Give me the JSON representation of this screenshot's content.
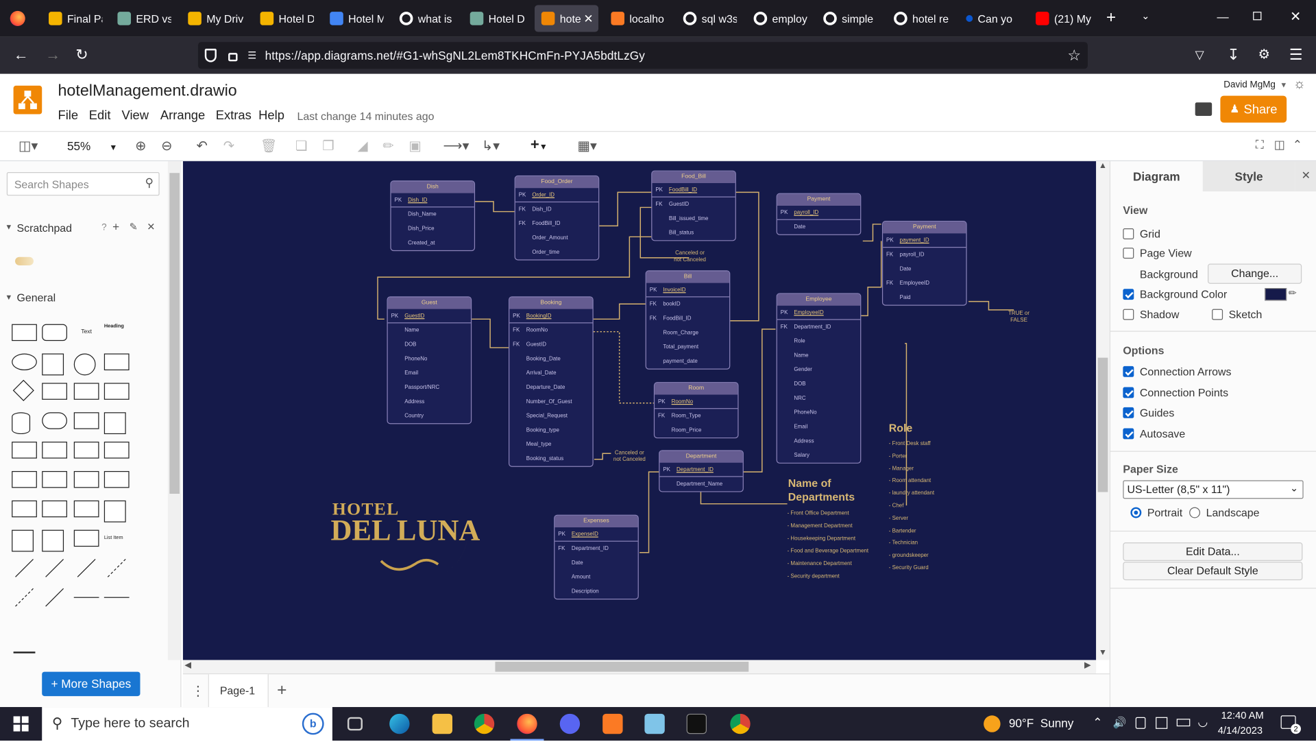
{
  "browser": {
    "tabs": [
      {
        "label": "Final Pa",
        "icon": "google-drive-icon",
        "color": "#f4b400"
      },
      {
        "label": "ERD vs",
        "icon": "chatgpt-icon",
        "color": "#74aa9c"
      },
      {
        "label": "My Driv",
        "icon": "google-drive-icon",
        "color": "#f4b400"
      },
      {
        "label": "Hotel D",
        "icon": "google-drive-icon",
        "color": "#f4b400"
      },
      {
        "label": "Hotel M",
        "icon": "google-docs-icon",
        "color": "#4285f4"
      },
      {
        "label": "what is",
        "icon": "google-icon",
        "color": "#ffffff"
      },
      {
        "label": "Hotel D",
        "icon": "chatgpt-icon",
        "color": "#74aa9c"
      },
      {
        "label": "hote",
        "icon": "drawio-icon",
        "color": "#f08705"
      },
      {
        "label": "localho",
        "icon": "xampp-icon",
        "color": "#fb7a24"
      },
      {
        "label": "sql w3s",
        "icon": "google-icon",
        "color": "#ffffff"
      },
      {
        "label": "employ",
        "icon": "google-icon",
        "color": "#ffffff"
      },
      {
        "label": "simple",
        "icon": "google-icon",
        "color": "#ffffff"
      },
      {
        "label": "hotel re",
        "icon": "google-icon",
        "color": "#ffffff"
      },
      {
        "label": "Can yo",
        "icon": "dot-icon",
        "color": "#0b57d0"
      },
      {
        "label": "(21) My",
        "icon": "youtube-icon",
        "color": "#ff0000"
      }
    ],
    "url": "https://app.diagrams.net/#G1-whSgNL2Lem8TKHCmFn-PYJA5bdtLzGy"
  },
  "app": {
    "title": "hotelManagement.drawio",
    "menu": [
      "File",
      "Edit",
      "View",
      "Arrange",
      "Extras",
      "Help"
    ],
    "last_change": "Last change 14 minutes ago",
    "user": "David MgMg",
    "share_label": "Share",
    "accent": "#f08705"
  },
  "toolbar": {
    "zoom": "55%"
  },
  "left_panel": {
    "search_placeholder": "Search Shapes",
    "scratchpad_label": "Scratchpad",
    "scratchpad_help": "?",
    "general_label": "General",
    "shape_text": "Text",
    "shape_heading": "Heading",
    "shape_list_item": "List Item",
    "more_shapes": "+ More Shapes"
  },
  "diagram": {
    "background": "#151a4a",
    "entities": [
      {
        "title": "Dish",
        "pk": "Dish_ID",
        "fields": [
          [
            "",
            "Dish_Name"
          ],
          [
            "",
            "Dish_Price"
          ],
          [
            "",
            "Created_at"
          ]
        ]
      },
      {
        "title": "Food_Order",
        "pk": "Order_ID",
        "fields": [
          [
            "FK",
            "Dish_ID"
          ],
          [
            "FK",
            "FoodBill_ID"
          ],
          [
            "",
            "Order_Amount"
          ],
          [
            "",
            "Order_time"
          ]
        ]
      },
      {
        "title": "Food_Bill",
        "pk": "FoodBill_ID",
        "fields": [
          [
            "FK",
            "GuestID"
          ],
          [
            "",
            "Bill_issued_time"
          ],
          [
            "",
            "Bill_status"
          ]
        ]
      },
      {
        "title": "Payment",
        "pk": "payroll_ID",
        "fields": [
          [
            "",
            "Date"
          ]
        ]
      },
      {
        "title": "Payment",
        "pk": "payment_ID",
        "fields": [
          [
            "FK",
            "payroll_ID"
          ],
          [
            "",
            "Date"
          ],
          [
            "FK",
            "EmployeeID"
          ],
          [
            "",
            "Paid"
          ]
        ]
      },
      {
        "title": "Guest",
        "pk": "GuestID",
        "fields": [
          [
            "",
            "Name"
          ],
          [
            "",
            "DOB"
          ],
          [
            "",
            "PhoneNo"
          ],
          [
            "",
            "Email"
          ],
          [
            "",
            "Passport/NRC"
          ],
          [
            "",
            "Address"
          ],
          [
            "",
            "Country"
          ]
        ]
      },
      {
        "title": "Booking",
        "pk": "BookingID",
        "fields": [
          [
            "FK",
            "RoomNo"
          ],
          [
            "FK",
            "GuestID"
          ],
          [
            "",
            "Booking_Date"
          ],
          [
            "",
            "Arrival_Date"
          ],
          [
            "",
            "Departure_Date"
          ],
          [
            "",
            "Number_Of_Guest"
          ],
          [
            "",
            "Special_Request"
          ],
          [
            "",
            "Booking_type"
          ],
          [
            "",
            "Meal_type"
          ],
          [
            "",
            "Booking_status"
          ]
        ]
      },
      {
        "title": "Bill",
        "pk": "InvoiceID",
        "fields": [
          [
            "FK",
            "bookID"
          ],
          [
            "FK",
            "FoodBill_ID"
          ],
          [
            "",
            "Room_Charge"
          ],
          [
            "",
            "Total_payment"
          ],
          [
            "",
            "payment_date"
          ]
        ]
      },
      {
        "title": "Room",
        "pk": "RoomNo",
        "fields": [
          [
            "FK",
            "Room_Type"
          ],
          [
            "",
            "Room_Price"
          ]
        ]
      },
      {
        "title": "Employee",
        "pk": "EmployeeID",
        "fields": [
          [
            "FK",
            "Department_ID"
          ],
          [
            "",
            "Role"
          ],
          [
            "",
            "Name"
          ],
          [
            "",
            "Gender"
          ],
          [
            "",
            "DOB"
          ],
          [
            "",
            "NRC"
          ],
          [
            "",
            "PhoneNo"
          ],
          [
            "",
            "Email"
          ],
          [
            "",
            "Address"
          ],
          [
            "",
            "Salary"
          ]
        ]
      },
      {
        "title": "Department",
        "pk": "Department_ID",
        "fields": [
          [
            "",
            "Department_Name"
          ]
        ]
      },
      {
        "title": "Expenses",
        "pk": "ExpenseID",
        "fields": [
          [
            "FK",
            "Department_ID"
          ],
          [
            "",
            "Date"
          ],
          [
            "",
            "Amount"
          ],
          [
            "",
            "Description"
          ]
        ]
      }
    ],
    "captions": {
      "food_bill_status": "Canceled or\nnot Canceled",
      "booking_status": "Canceled or\nnot Canceled",
      "paid": "TRUE or\nFALSE"
    },
    "logo": {
      "line1": "HOTEL",
      "line2": "DEL LUNA"
    },
    "departments_title": "Name of\nDepartments",
    "departments": [
      "- Front Office Department",
      "- Management Department",
      "- Housekeeping Department",
      "- Food and Beverage Department",
      "- Maintenance Department",
      "- Security department"
    ],
    "role_title": "Role",
    "roles": [
      "- Front Desk staff",
      "- Porter",
      "- Manager",
      "- Room attendant",
      "- laundry attendant",
      "- Chef",
      "- Server",
      "- Bartender",
      "- Technician",
      "- groundskeeper",
      "- Security Guard"
    ]
  },
  "right_panel": {
    "tabs": [
      "Diagram",
      "Style"
    ],
    "view_label": "View",
    "grid": "Grid",
    "page_view": "Page View",
    "background": "Background",
    "change": "Change...",
    "background_color": "Background Color",
    "bg_swatch": "#151a4a",
    "shadow": "Shadow",
    "sketch": "Sketch",
    "options_label": "Options",
    "connection_arrows": "Connection Arrows",
    "connection_points": "Connection Points",
    "guides": "Guides",
    "autosave": "Autosave",
    "paper_size_label": "Paper Size",
    "paper_size": "US-Letter (8,5\" x 11\")",
    "portrait": "Portrait",
    "landscape": "Landscape",
    "edit_data": "Edit Data...",
    "clear_style": "Clear Default Style"
  },
  "pagebar": {
    "page": "Page-1"
  },
  "taskbar": {
    "search_placeholder": "Type here to search",
    "weather": "90°F  Sunny",
    "time": "12:40 AM",
    "date": "4/14/2023",
    "notifications": "2"
  }
}
